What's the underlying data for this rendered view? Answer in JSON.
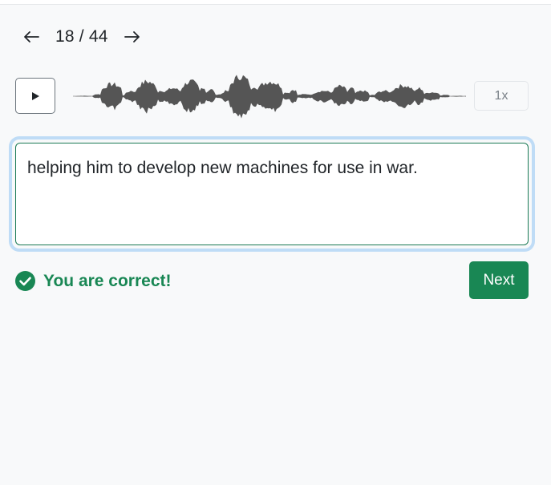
{
  "navigation": {
    "prev_icon": "arrow-left-icon",
    "next_icon": "arrow-right-icon",
    "counter": "18 / 44"
  },
  "player": {
    "play_icon": "play-icon",
    "speed_label": "1x",
    "waveform_color": "#555555"
  },
  "answer": {
    "text": "helping him to develop new machines for use in war."
  },
  "feedback": {
    "icon": "check-circle-icon",
    "message": "You are correct!",
    "color": "#198754"
  },
  "actions": {
    "next_label": "Next",
    "next_color": "#198754"
  }
}
